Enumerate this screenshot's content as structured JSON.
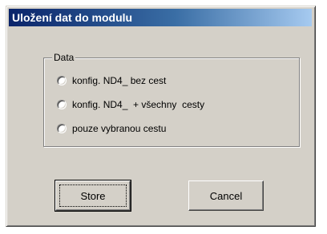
{
  "dialog": {
    "title": "Uložení dat do modulu"
  },
  "group": {
    "legend": "Data",
    "options": [
      {
        "label": "konfig. ND4_ bez cest",
        "selected": false
      },
      {
        "label": "konfig. ND4_  + všechny  cesty",
        "selected": false
      },
      {
        "label": "pouze vybranou cestu",
        "selected": false
      }
    ]
  },
  "buttons": {
    "store_label": "Store",
    "cancel_label": "Cancel"
  }
}
